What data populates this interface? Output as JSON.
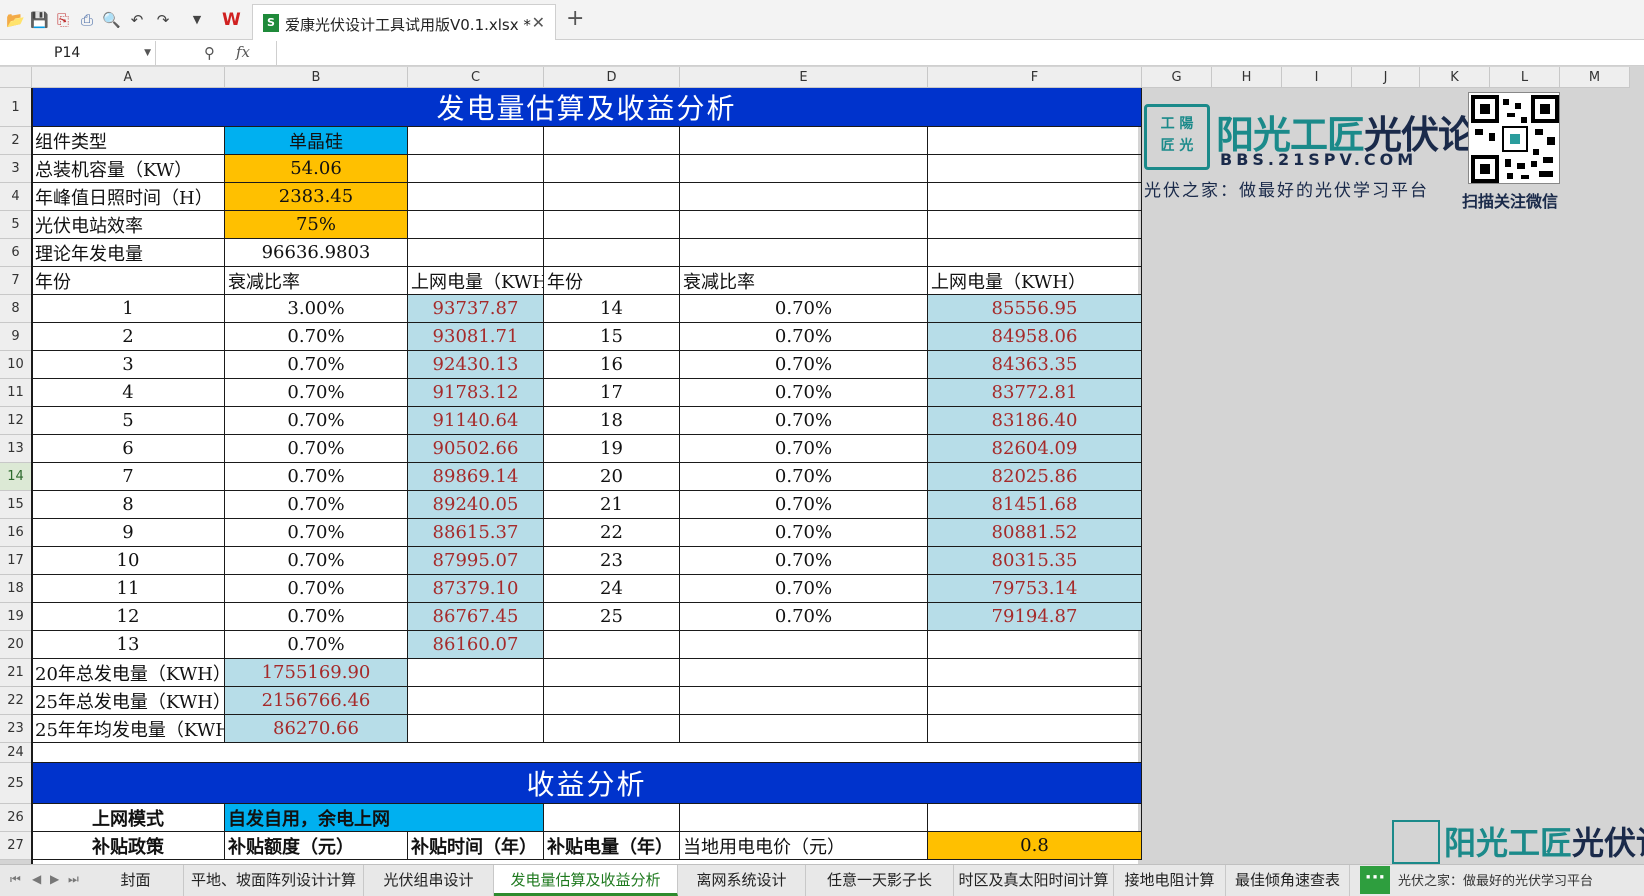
{
  "toolbar": {
    "file_tab_title": "爱康光伏设计工具试用版V0.1.xlsx *",
    "close_glyph": "✕",
    "new_tab_glyph": "+"
  },
  "formula_bar": {
    "cell_ref": "P14",
    "fx_label": "fx",
    "formula": ""
  },
  "columns": [
    "A",
    "B",
    "C",
    "D",
    "E",
    "F",
    "G",
    "H",
    "I",
    "J",
    "K",
    "L",
    "M"
  ],
  "rows": [
    "1",
    "2",
    "3",
    "4",
    "5",
    "6",
    "7",
    "8",
    "9",
    "10",
    "11",
    "12",
    "13",
    "14",
    "15",
    "16",
    "17",
    "18",
    "19",
    "20",
    "21",
    "22",
    "23",
    "24",
    "25",
    "26",
    "27"
  ],
  "selected_row": "14",
  "sheet": {
    "title": "发电量估算及收益分析",
    "labels": {
      "component_type": "组件类型",
      "capacity": "总装机容量（KW）",
      "sun_hours": "年峰值日照时间（H）",
      "efficiency": "光伏电站效率",
      "theoretical": "理论年发电量"
    },
    "values": {
      "component_type": "单晶硅",
      "capacity": "54.06",
      "sun_hours": "2383.45",
      "efficiency": "75%",
      "theoretical": "96636.9803"
    },
    "table_header": {
      "year": "年份",
      "decay": "衰减比率",
      "grid_power": "上网电量（KWH",
      "year2": "年份",
      "decay2": "衰减比率",
      "grid_power2": "上网电量（KWH）"
    },
    "left_table": [
      {
        "year": "1",
        "decay": "3.00%",
        "power": "93737.87"
      },
      {
        "year": "2",
        "decay": "0.70%",
        "power": "93081.71"
      },
      {
        "year": "3",
        "decay": "0.70%",
        "power": "92430.13"
      },
      {
        "year": "4",
        "decay": "0.70%",
        "power": "91783.12"
      },
      {
        "year": "5",
        "decay": "0.70%",
        "power": "91140.64"
      },
      {
        "year": "6",
        "decay": "0.70%",
        "power": "90502.66"
      },
      {
        "year": "7",
        "decay": "0.70%",
        "power": "89869.14"
      },
      {
        "year": "8",
        "decay": "0.70%",
        "power": "89240.05"
      },
      {
        "year": "9",
        "decay": "0.70%",
        "power": "88615.37"
      },
      {
        "year": "10",
        "decay": "0.70%",
        "power": "87995.07"
      },
      {
        "year": "11",
        "decay": "0.70%",
        "power": "87379.10"
      },
      {
        "year": "12",
        "decay": "0.70%",
        "power": "86767.45"
      },
      {
        "year": "13",
        "decay": "0.70%",
        "power": "86160.07"
      }
    ],
    "right_table": [
      {
        "year": "14",
        "decay": "0.70%",
        "power": "85556.95"
      },
      {
        "year": "15",
        "decay": "0.70%",
        "power": "84958.06"
      },
      {
        "year": "16",
        "decay": "0.70%",
        "power": "84363.35"
      },
      {
        "year": "17",
        "decay": "0.70%",
        "power": "83772.81"
      },
      {
        "year": "18",
        "decay": "0.70%",
        "power": "83186.40"
      },
      {
        "year": "19",
        "decay": "0.70%",
        "power": "82604.09"
      },
      {
        "year": "20",
        "decay": "0.70%",
        "power": "82025.86"
      },
      {
        "year": "21",
        "decay": "0.70%",
        "power": "81451.68"
      },
      {
        "year": "22",
        "decay": "0.70%",
        "power": "80881.52"
      },
      {
        "year": "23",
        "decay": "0.70%",
        "power": "80315.35"
      },
      {
        "year": "24",
        "decay": "0.70%",
        "power": "79753.14"
      },
      {
        "year": "25",
        "decay": "0.70%",
        "power": "79194.87"
      }
    ],
    "totals": {
      "label_20y": "20年总发电量（KWH）",
      "value_20y": "1755169.90",
      "label_25y": "25年总发电量（KWH）",
      "value_25y": "2156766.46",
      "label_avg": "25年年均发电量（KWH",
      "value_avg": "86270.66"
    },
    "revenue_title": "收益分析",
    "revenue": {
      "mode_label": "上网模式",
      "mode_value": "自发自用，余电上网",
      "subsidy_label": "补贴政策",
      "subsidy_amount": "补贴额度（元）",
      "subsidy_time": "补贴时间（年）",
      "subsidy_power": "补贴电量（年）",
      "local_price_label": "当地用电电价（元）",
      "local_price_value": "0.8"
    }
  },
  "branding": {
    "emblem": "工 陽\n匠 光",
    "title_a": "阳光工匠",
    "title_b": "光伏论坛",
    "url": "BBS.21SPV.COM",
    "slogan": "光伏之家：做最好的光伏学习平台",
    "qr_caption": "扫描关注微信"
  },
  "sheet_tabs": [
    "封面",
    "平地、坡面阵列设计计算",
    "光伏组串设计",
    "发电量估算及收益分析",
    "离网系统设计",
    "任意一天影子长",
    "时区及真太阳时间计算",
    "接地电阻计算",
    "最佳倾角速查表"
  ],
  "active_sheet": "发电量估算及收益分析",
  "status_slogan": "光伏之家：做最好的光伏学习平台",
  "colors": {
    "banner_blue": "#0033cc",
    "header_cell_blue": "#00b0f0",
    "input_orange": "#ffc000",
    "result_light_blue": "#b7dde8",
    "result_text_red": "#a52a2a",
    "brand_teal": "#1b8a8a",
    "active_tab_green": "#2e8b2e"
  },
  "icons": [
    "open-folder-icon",
    "save-icon",
    "export-pdf-icon",
    "print-icon",
    "print-preview-icon",
    "undo-icon",
    "redo-icon",
    "dropdown-icon",
    "wps-logo-icon",
    "excel-file-icon",
    "zoom-icon"
  ]
}
